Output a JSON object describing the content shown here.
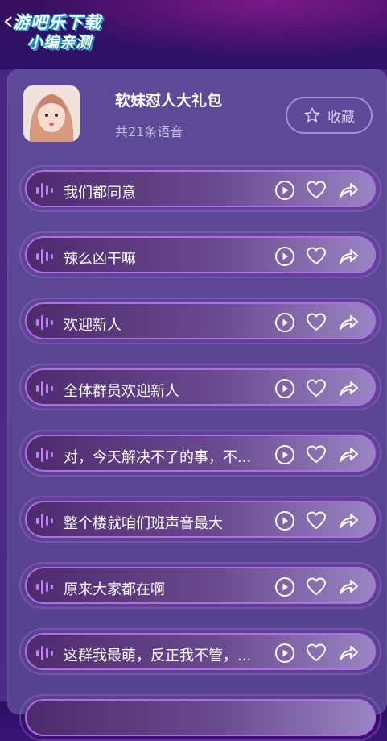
{
  "header": {
    "logo_line1": "游吧乐下载",
    "logo_line2": "小编亲测"
  },
  "pack": {
    "title": "软妹怼人大礼包",
    "count": "共21条语音",
    "favorite_label": "收藏"
  },
  "items": [
    {
      "label": "我们都同意"
    },
    {
      "label": "辣么凶干嘛"
    },
    {
      "label": "欢迎新人"
    },
    {
      "label": "全体群员欢迎新人"
    },
    {
      "label": "对，今天解决不了的事，不..."
    },
    {
      "label": "整个楼就咱们班声音最大"
    },
    {
      "label": "原来大家都在啊"
    },
    {
      "label": "这群我最萌，反正我不管，..."
    }
  ],
  "colors": {
    "accent": "#b46ce6",
    "wave": "#c47bff"
  }
}
